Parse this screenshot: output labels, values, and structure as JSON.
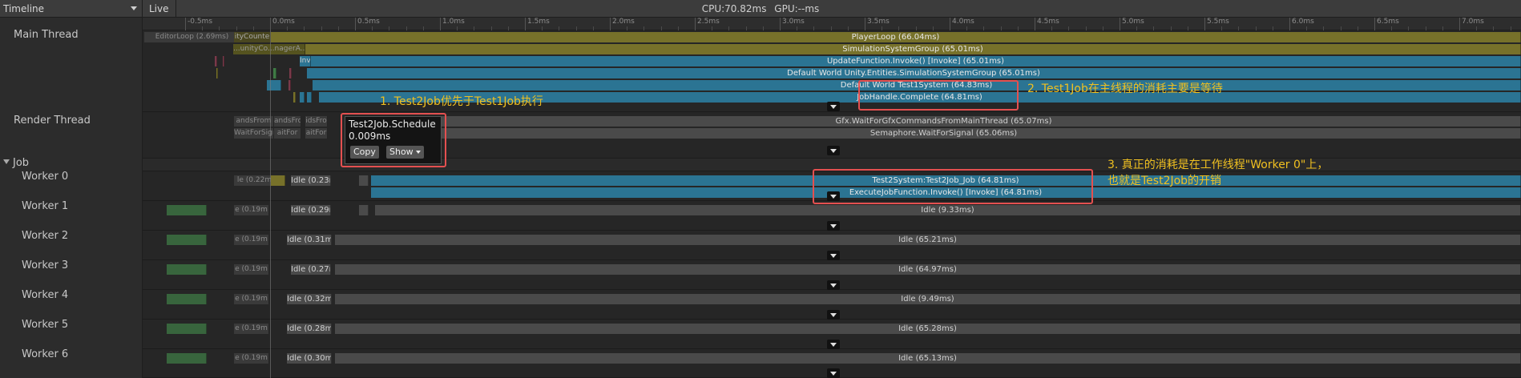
{
  "toolbar": {
    "view": "Timeline",
    "live": "Live",
    "cpu": "CPU:70.82ms",
    "gpu": "GPU:--ms"
  },
  "ruler": {
    "ticks": [
      "-0.5ms",
      "0.0ms",
      "0.5ms",
      "1.0ms",
      "1.5ms",
      "2.0ms",
      "2.5ms",
      "3.0ms",
      "3.5ms",
      "4.0ms",
      "4.5ms",
      "5.0ms",
      "5.5ms",
      "6.0ms",
      "6.5ms",
      "7.0ms"
    ]
  },
  "threads": {
    "main": "Main Thread",
    "render": "Render Thread",
    "job_group": "Job",
    "workers": [
      "Worker 0",
      "Worker 1",
      "Worker 2",
      "Worker 3",
      "Worker 4",
      "Worker 5",
      "Worker 6"
    ]
  },
  "main_thread": {
    "editor_loop": "EditorLoop (2.69ms)",
    "player_loop": "PlayerLoop (66.04ms)",
    "ticker": "ityCounte",
    "sim_group": "SimulationSystemGroup (65.01ms)",
    "manager_fragment": "...unityCo...nagerA...stem(",
    "update_fn": "UpdateFunction.Invoke() [Invoke] (65.01ms)",
    "invoke_fragment": "Invoke",
    "default_world": "Default World Unity.Entities.SimulationSystemGroup (65.01ms)",
    "test1_system": "Default World Test1System (64.83ms)",
    "job_complete": "JobHandle.Complete (64.81ms)"
  },
  "render_thread": {
    "wait_gfx": "Gfx.WaitForGfxCommandsFromMainThread (65.07ms)",
    "wait_signal": "Semaphore.WaitForSignal (65.06ms)",
    "frag_1": "andsFrom",
    "frag_2": "andsFro",
    "frag_3": "idsFro",
    "frag_4": "WaitForSignal",
    "frag_5": "aitFor",
    "frag_6": "aitFor"
  },
  "workers": {
    "w0_idle_left": "le (0.22m",
    "w0_idle": "Idle (0.23m",
    "w0_job": "Test2System:Test2Job_Job (64.81ms)",
    "w0_exec": "ExecuteJobFunction.Invoke() [Invoke] (64.81ms)",
    "w1_left": "e (0.19m",
    "w1_idle": "Idle (0.29ms)",
    "w1_long": "Idle (9.33ms)",
    "w2_left": "e (0.19m",
    "w2_idle": "Idle (0.31ms)",
    "w2_long": "Idle (65.21ms)",
    "w3_left": "e (0.19m",
    "w3_idle": "Idle (0.27ms",
    "w3_long": "Idle (64.97ms)",
    "w4_left": "e (0.19m",
    "w4_idle": "Idle (0.32ms)",
    "w4_long": "Idle (9.49ms)",
    "w5_left": "e (0.19m",
    "w5_idle": "Idle (0.28ms)",
    "w5_long": "Idle (65.28ms)",
    "w6_left": "e (0.19m",
    "w6_idle": "Idle (0.30ms)",
    "w6_long": "Idle (65.13ms)"
  },
  "tooltip": {
    "name": "Test2Job.Schedule",
    "duration": "0.009ms",
    "copy": "Copy",
    "show": "Show"
  },
  "annotations": {
    "a1": "1. Test2Job优先于Test1Job执行",
    "a2": "2. Test1Job在主线程的消耗主要是等待",
    "a3_line1": "3. 真正的消耗是在工作线程\"Worker 0\"上，",
    "a3_line2": "也就是Test2Job的开销"
  },
  "colors": {
    "player_loop": "#77712a",
    "system": "#2b7493",
    "idle": "#4a4a4a",
    "annotation": "#f0c020",
    "highlight": "#e45050"
  }
}
